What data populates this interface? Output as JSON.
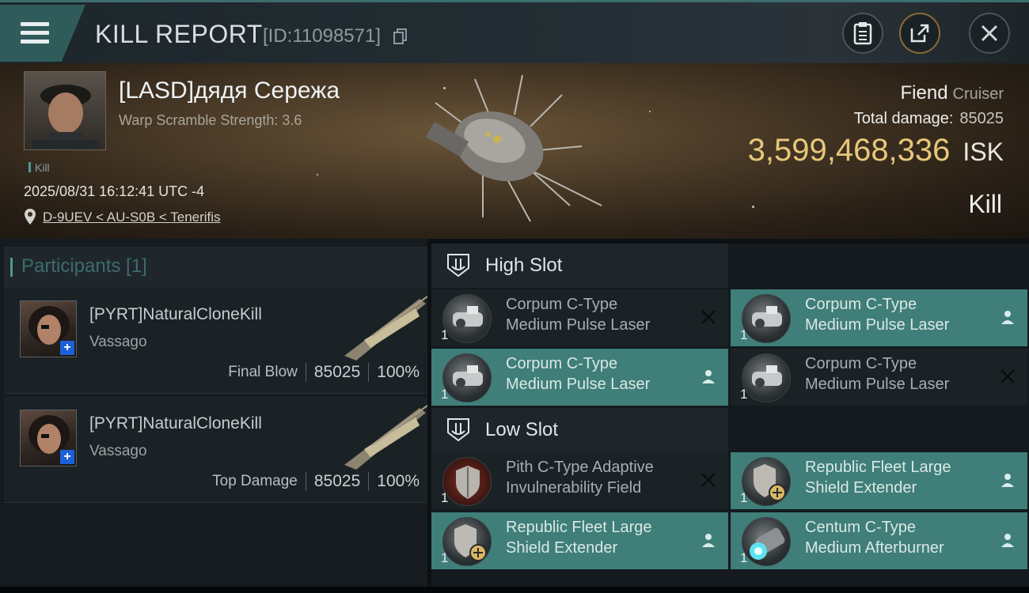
{
  "header": {
    "title": "KILL REPORT",
    "report_id": "[ID:11098571]",
    "icons": [
      "menu-icon",
      "copy-icon",
      "clipboard-icon",
      "share-icon",
      "close-icon"
    ]
  },
  "victim": {
    "name": "[LASD]дядя Сережа",
    "warp_scramble": "Warp Scramble Strength: 3.6",
    "kill_tag": "Kill",
    "datetime": "2025/08/31 16:12:41 UTC -4",
    "location": "D-9UEV < AU-S0B < Tenerifis",
    "ship_name": "Fiend",
    "ship_class": "Cruiser",
    "total_damage_label": "Total damage:",
    "total_damage": "85025",
    "isk_value": "3,599,468,336",
    "isk_unit": "ISK",
    "result": "Kill"
  },
  "participants": {
    "title": "Participants [1]",
    "rows": [
      {
        "name": "[PYRT]NaturalCloneKill",
        "ship": "Vassago",
        "role": "Final Blow",
        "damage": "85025",
        "percent": "100%"
      },
      {
        "name": "[PYRT]NaturalCloneKill",
        "ship": "Vassago",
        "role": "Top Damage",
        "damage": "85025",
        "percent": "100%"
      }
    ]
  },
  "slots": {
    "high": {
      "title": "High Slot",
      "items": [
        {
          "qty": "1",
          "line1": "Corpum C-Type",
          "line2": "Medium Pulse Laser",
          "state": "destroyed"
        },
        {
          "qty": "1",
          "line1": "Corpum C-Type",
          "line2": "Medium Pulse Laser",
          "state": "dropped"
        },
        {
          "qty": "1",
          "line1": "Corpum C-Type",
          "line2": "Medium Pulse Laser",
          "state": "dropped"
        },
        {
          "qty": "1",
          "line1": "Corpum C-Type",
          "line2": "Medium Pulse Laser",
          "state": "destroyed"
        }
      ]
    },
    "low": {
      "title": "Low Slot",
      "items": [
        {
          "qty": "1",
          "line1": "Pith C-Type Adaptive",
          "line2": "Invulnerability Field",
          "state": "destroyed"
        },
        {
          "qty": "1",
          "line1": "Republic Fleet Large",
          "line2": "Shield Extender",
          "state": "dropped"
        },
        {
          "qty": "1",
          "line1": "Republic Fleet Large",
          "line2": "Shield Extender",
          "state": "dropped"
        },
        {
          "qty": "1",
          "line1": "Centum C-Type",
          "line2": "Medium Afterburner",
          "state": "dropped"
        }
      ]
    }
  },
  "colors": {
    "accent_teal": "#3f7e79",
    "isk_gold": "#e7c77a",
    "header_bg": "#232d33"
  }
}
